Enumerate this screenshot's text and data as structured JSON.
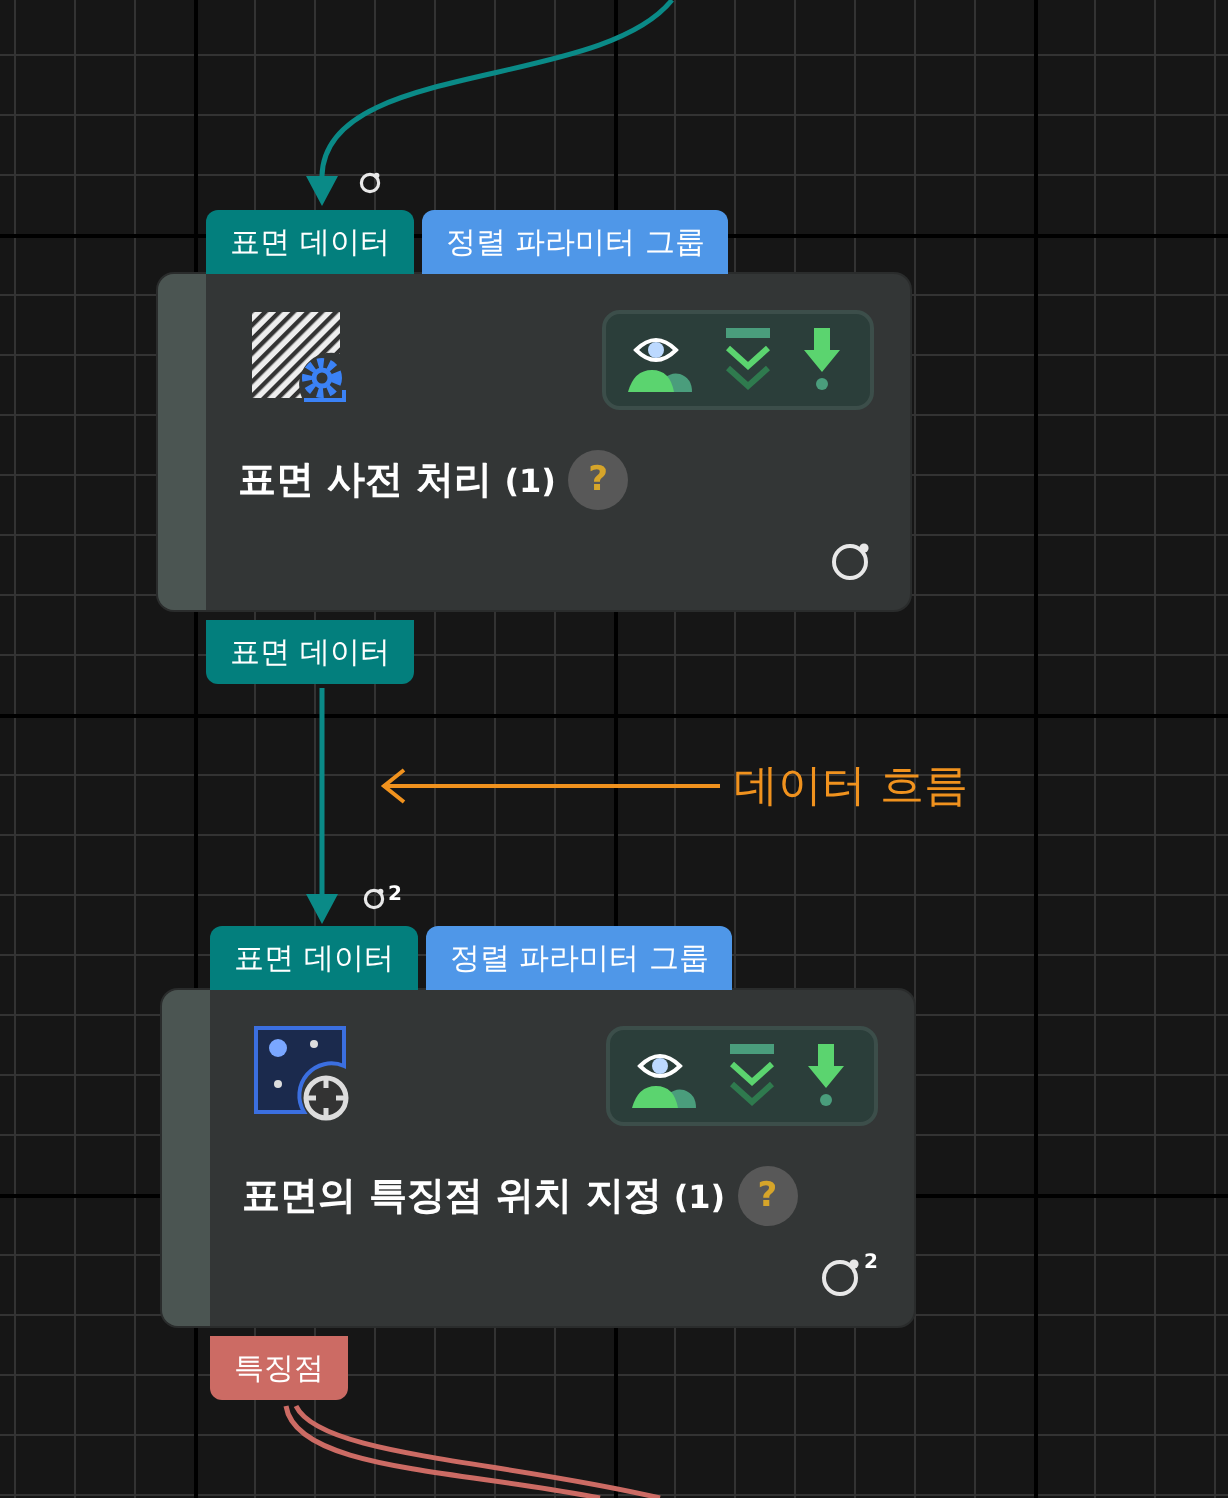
{
  "canvas": {
    "annotation": {
      "label": "데이터 흐름"
    },
    "nodes": [
      {
        "kind": "preprocess",
        "title": "표면 사전 처리",
        "count": "(1)",
        "help": "?",
        "inputs": [
          {
            "label": "표면 데이터",
            "color": "#037f7d"
          },
          {
            "label": "정렬 파라미터 그룹",
            "color": "#4f97e8"
          }
        ],
        "outputs": [
          {
            "label": "표면 데이터",
            "color": "#037f7d"
          }
        ]
      },
      {
        "kind": "locate",
        "title": "표면의 특징점 위치 지정",
        "count": "(1)",
        "help": "?",
        "input_loop_badge": "2",
        "card_loop_badge": "2",
        "inputs": [
          {
            "label": "표면 데이터",
            "color": "#037f7d"
          },
          {
            "label": "정렬 파라미터 그룹",
            "color": "#4f97e8"
          }
        ],
        "outputs": [
          {
            "label": "특징점",
            "color": "#cc6b64"
          }
        ]
      }
    ]
  }
}
